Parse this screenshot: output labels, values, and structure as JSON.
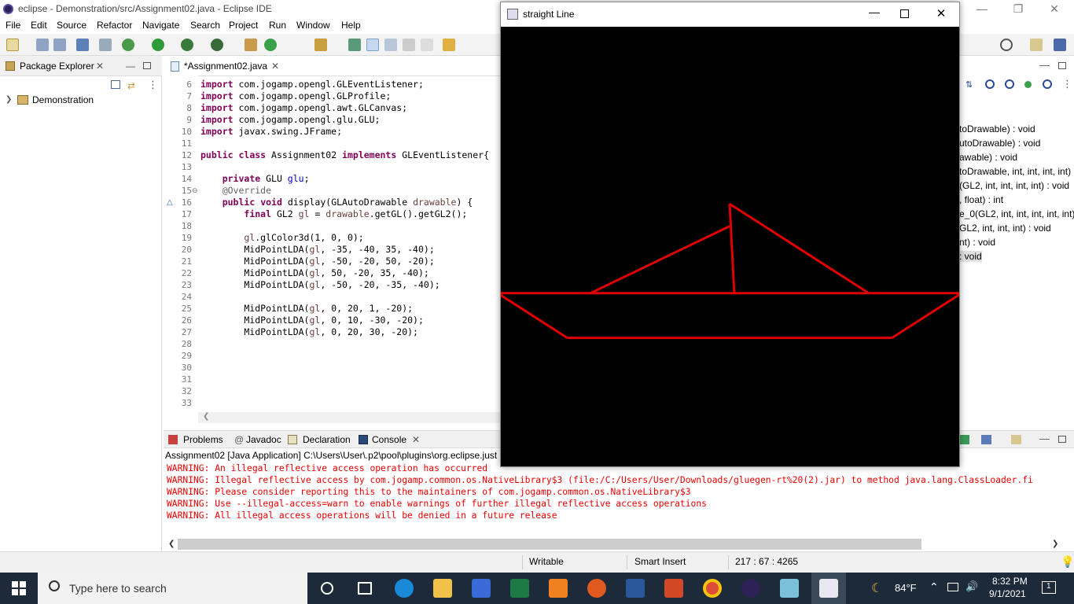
{
  "eclipse": {
    "window_title": "eclipse - Demonstration/src/Assignment02.java - Eclipse IDE",
    "menu": [
      "File",
      "Edit",
      "Source",
      "Refactor",
      "Navigate",
      "Search",
      "Project",
      "Run",
      "Window",
      "Help"
    ]
  },
  "package_explorer": {
    "tab_label": "Package Explorer",
    "project": "Demonstration"
  },
  "editor": {
    "tab_label": "*Assignment02.java",
    "lines": [
      {
        "n": "6",
        "code": "import com.jogamp.opengl.GLEventListener;"
      },
      {
        "n": "7",
        "code": "import com.jogamp.opengl.GLProfile;"
      },
      {
        "n": "8",
        "code": "import com.jogamp.opengl.awt.GLCanvas;"
      },
      {
        "n": "9",
        "code": "import com.jogamp.opengl.glu.GLU;"
      },
      {
        "n": "10",
        "code": "import javax.swing.JFrame;"
      },
      {
        "n": "11",
        "code": ""
      },
      {
        "n": "12",
        "code": "public class Assignment02 implements GLEventListener{"
      },
      {
        "n": "13",
        "code": ""
      },
      {
        "n": "14",
        "code": "    private GLU glu;"
      },
      {
        "n": "15",
        "code": "    @Override"
      },
      {
        "n": "16",
        "code": "    public void display(GLAutoDrawable drawable) {"
      },
      {
        "n": "17",
        "code": "        final GL2 gl = drawable.getGL().getGL2();"
      },
      {
        "n": "18",
        "code": ""
      },
      {
        "n": "19",
        "code": "        gl.glColor3d(1, 0, 0);"
      },
      {
        "n": "20",
        "code": "        MidPointLDA(gl, -35, -40, 35, -40);"
      },
      {
        "n": "21",
        "code": "        MidPointLDA(gl, -50, -20, 50, -20);"
      },
      {
        "n": "22",
        "code": "        MidPointLDA(gl, 50, -20, 35, -40);"
      },
      {
        "n": "23",
        "code": "        MidPointLDA(gl, -50, -20, -35, -40);"
      },
      {
        "n": "24",
        "code": ""
      },
      {
        "n": "25",
        "code": "        MidPointLDA(gl, 0, 20, 1, -20);"
      },
      {
        "n": "26",
        "code": "        MidPointLDA(gl, 0, 10, -30, -20);"
      },
      {
        "n": "27",
        "code": "        MidPointLDA(gl, 0, 20, 30, -20);"
      },
      {
        "n": "28",
        "code": ""
      },
      {
        "n": "29",
        "code": ""
      },
      {
        "n": "30",
        "code": ""
      },
      {
        "n": "31",
        "code": ""
      },
      {
        "n": "32",
        "code": ""
      },
      {
        "n": "33",
        "code": ""
      }
    ]
  },
  "outline": {
    "items": [
      "toDrawable) : void",
      "utoDrawable) : void",
      "awable) : void",
      "toDrawable, int, int, int, int)",
      "(GL2, int, int, int, int) : void",
      ", float) : int",
      "e_0(GL2, int, int, int, int, int)",
      "GL2, int, int, int) : void",
      "nt) : void",
      ": void"
    ]
  },
  "console": {
    "tabs": [
      "Problems",
      "Javadoc",
      "Declaration",
      "Console"
    ],
    "launch": "Assignment02 [Java Application] C:\\Users\\User\\.p2\\pool\\plugins\\org.eclipse.just",
    "warnings": [
      "WARNING: An illegal reflective access operation has occurred",
      "WARNING: Illegal reflective access by com.jogamp.common.os.NativeLibrary$3 (file:/C:/Users/User/Downloads/gluegen-rt%20(2).jar) to method java.lang.ClassLoader.fi",
      "WARNING: Please consider reporting this to the maintainers of com.jogamp.common.os.NativeLibrary$3",
      "WARNING: Use --illegal-access=warn to enable warnings of further illegal reflective access operations",
      "WARNING: All illegal access operations will be denied in a future release"
    ]
  },
  "status": {
    "writable": "Writable",
    "insert_mode": "Smart Insert",
    "position": "217 : 67 : 4265"
  },
  "gl_window": {
    "title": "straight Line",
    "line_color": "#e00000"
  },
  "taskbar": {
    "search_placeholder": "Type here to search",
    "weather": "84°F",
    "time": "8:32 PM",
    "date": "9/1/2021",
    "notification_count": "1"
  }
}
